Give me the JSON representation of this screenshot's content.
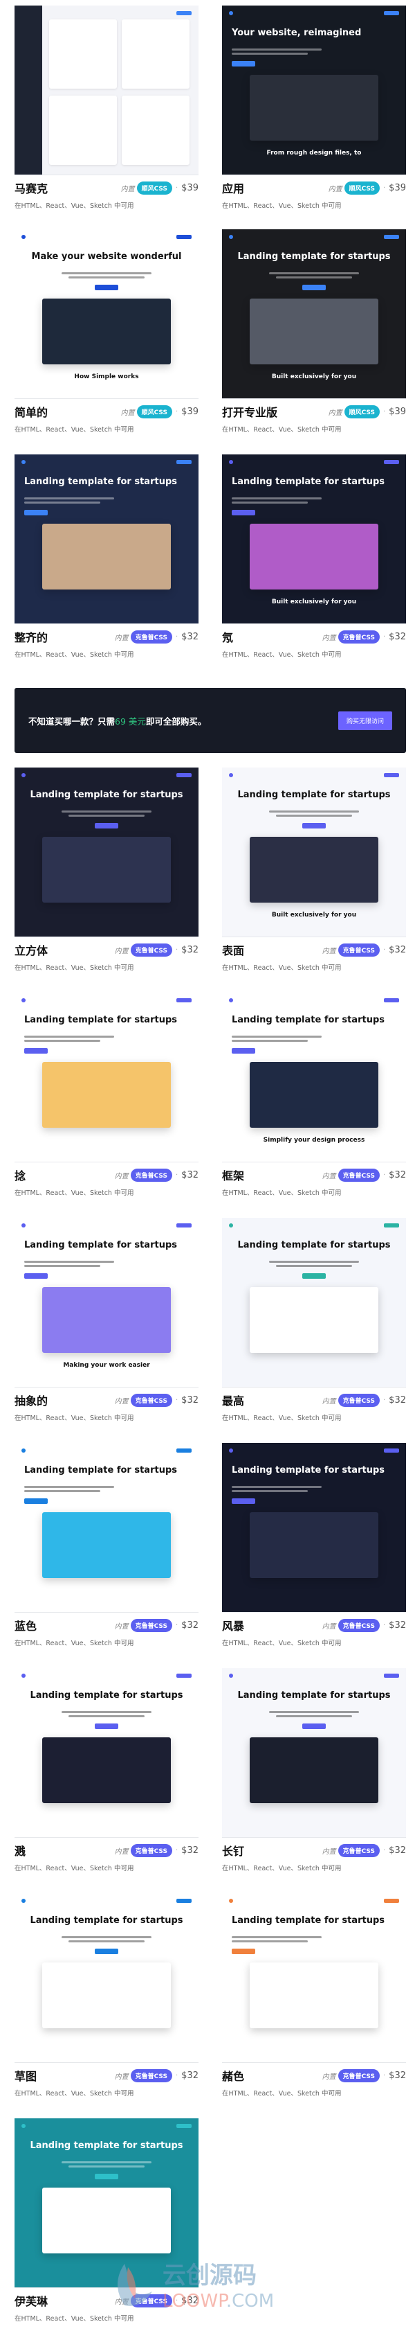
{
  "common": {
    "builtin_label": "内置",
    "availability": "在HTML、React、Vue、Sketch 中可用",
    "separator": "·"
  },
  "colors": {
    "tailwind_badge": "#1ab3cf",
    "crup_badge": "#5b5ff0",
    "banner_bg": "#171b26",
    "banner_highlight": "#2ec27e",
    "banner_button": "#6c63ff"
  },
  "banner": {
    "text_before": "不知道买哪一款？只需",
    "highlight": "69 美元",
    "text_after": "即可全部购买。",
    "button_label": "购买无限访问"
  },
  "templates": [
    {
      "name": "马赛克",
      "badge": "顺风CSS",
      "badge_color": "#1ab3cf",
      "price": "$39",
      "bg": "#f3f4f8",
      "fg": "#111",
      "accent": "#3b82f6",
      "headline": "",
      "subhead": "",
      "mock": "#ffffff",
      "layout": "dash"
    },
    {
      "name": "应用",
      "badge": "顺风CSS",
      "badge_color": "#1ab3cf",
      "price": "$39",
      "bg": "#151a23",
      "fg": "#fff",
      "accent": "#3b82f6",
      "headline": "Your website, reimagined",
      "subhead": "From rough design files, to",
      "mock": "#2a2f3a",
      "layout": "left"
    },
    {
      "name": "简单的",
      "badge": "顺风CSS",
      "badge_color": "#1ab3cf",
      "price": "$39",
      "bg": "#ffffff",
      "fg": "#111",
      "accent": "#1d4ed8",
      "headline": "Make your website wonderful",
      "subhead": "How Simple works",
      "mock": "#1e293b",
      "layout": "center"
    },
    {
      "name": "打开专业版",
      "badge": "顺风CSS",
      "badge_color": "#1ab3cf",
      "price": "$39",
      "bg": "#1b1c20",
      "fg": "#fff",
      "accent": "#3b82f6",
      "headline": "Landing template for startups",
      "subhead": "Built exclusively for you",
      "mock": "#555a66",
      "layout": "center"
    },
    {
      "name": "整齐的",
      "badge": "克鲁普CSS",
      "badge_color": "#5b5ff0",
      "price": "$32",
      "bg": "#1e2a4a",
      "fg": "#fff",
      "accent": "#3b82f6",
      "headline": "Landing template for startups",
      "subhead": "",
      "mock": "#c9a98a",
      "layout": "left"
    },
    {
      "name": "氖",
      "badge": "克鲁普CSS",
      "badge_color": "#5b5ff0",
      "price": "$32",
      "bg": "#151a2b",
      "fg": "#fff",
      "accent": "#5b5ff0",
      "headline": "Landing template for startups",
      "subhead": "Built exclusively for you",
      "mock": "#b05cc8",
      "layout": "left"
    },
    {
      "name": "立方体",
      "badge": "克鲁普CSS",
      "badge_color": "#5b5ff0",
      "price": "$32",
      "bg": "#1a1d2e",
      "fg": "#fff",
      "accent": "#5b5ff0",
      "headline": "Landing template for startups",
      "subhead": "",
      "mock": "#2d3350",
      "layout": "center"
    },
    {
      "name": "表面",
      "badge": "克鲁普CSS",
      "badge_color": "#5b5ff0",
      "price": "$32",
      "bg": "#f6f7fb",
      "fg": "#111",
      "accent": "#5b5ff0",
      "headline": "Landing template for startups",
      "subhead": "Built exclusively for you",
      "mock": "#2b2f45",
      "layout": "center"
    },
    {
      "name": "捻",
      "badge": "克鲁普CSS",
      "badge_color": "#5b5ff0",
      "price": "$32",
      "bg": "#ffffff",
      "fg": "#111",
      "accent": "#5b5ff0",
      "headline": "Landing template for startups",
      "subhead": "",
      "mock": "#f5c46a",
      "layout": "left"
    },
    {
      "name": "框架",
      "badge": "克鲁普CSS",
      "badge_color": "#5b5ff0",
      "price": "$32",
      "bg": "#ffffff",
      "fg": "#111",
      "accent": "#5b5ff0",
      "headline": "Landing template for startups",
      "subhead": "Simplify your design process",
      "mock": "#1f2a44",
      "layout": "left"
    },
    {
      "name": "抽象的",
      "badge": "克鲁普CSS",
      "badge_color": "#5b5ff0",
      "price": "$32",
      "bg": "#ffffff",
      "fg": "#111",
      "accent": "#5b5ff0",
      "headline": "Landing template for startups",
      "subhead": "Making your work easier",
      "mock": "#8b7cf0",
      "layout": "left"
    },
    {
      "name": "最高",
      "badge": "克鲁普CSS",
      "badge_color": "#5b5ff0",
      "price": "$32",
      "bg": "#f4f6fb",
      "fg": "#111",
      "accent": "#2bb3a3",
      "headline": "Landing template for startups",
      "subhead": "",
      "mock": "#ffffff",
      "layout": "center"
    },
    {
      "name": "蓝色",
      "badge": "克鲁普CSS",
      "badge_color": "#5b5ff0",
      "price": "$32",
      "bg": "#ffffff",
      "fg": "#111",
      "accent": "#1a7fe0",
      "headline": "Landing template for startups",
      "subhead": "",
      "mock": "#2fb7e8",
      "layout": "left"
    },
    {
      "name": "风暴",
      "badge": "克鲁普CSS",
      "badge_color": "#5b5ff0",
      "price": "$32",
      "bg": "#14182a",
      "fg": "#fff",
      "accent": "#5b5ff0",
      "headline": "Landing template for startups",
      "subhead": "",
      "mock": "#252b45",
      "layout": "left"
    },
    {
      "name": "溅",
      "badge": "克鲁普CSS",
      "badge_color": "#5b5ff0",
      "price": "$32",
      "bg": "#ffffff",
      "fg": "#111",
      "accent": "#5b5ff0",
      "headline": "Landing template for startups",
      "subhead": "",
      "mock": "#1c1f33",
      "layout": "center"
    },
    {
      "name": "长钉",
      "badge": "克鲁普CSS",
      "badge_color": "#5b5ff0",
      "price": "$32",
      "bg": "#f6f7fb",
      "fg": "#111",
      "accent": "#5b5ff0",
      "headline": "Landing template for startups",
      "subhead": "",
      "mock": "#1b1f2e",
      "layout": "center"
    },
    {
      "name": "草图",
      "badge": "克鲁普CSS",
      "badge_color": "#5b5ff0",
      "price": "$32",
      "bg": "#ffffff",
      "fg": "#111",
      "accent": "#1a7fe0",
      "headline": "Landing template for startups",
      "subhead": "",
      "mock": "#ffffff",
      "layout": "center"
    },
    {
      "name": "赭色",
      "badge": "克鲁普CSS",
      "badge_color": "#5b5ff0",
      "price": "$32",
      "bg": "#ffffff",
      "fg": "#111",
      "accent": "#f0803c",
      "headline": "Landing template for startups",
      "subhead": "",
      "mock": "#ffffff",
      "layout": "left"
    },
    {
      "name": "伊芙琳",
      "badge": "克鲁普CSS",
      "badge_color": "#5b5ff0",
      "price": "$32",
      "bg": "#1a8f9c",
      "fg": "#fff",
      "accent": "#2ec0c9",
      "headline": "Landing template for startups",
      "subhead": "",
      "mock": "#ffffff",
      "layout": "center"
    }
  ],
  "watermark": {
    "brand": "云创源码",
    "domain": "LOOWP.COM"
  }
}
